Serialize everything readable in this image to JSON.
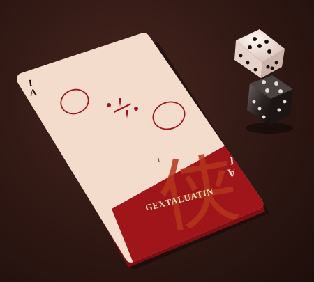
{
  "card": {
    "corner_top": [
      "I",
      "A"
    ],
    "corner_right": [
      "A",
      "I"
    ],
    "center_mark": "I",
    "brand_text": "GEXTALUATIN",
    "colors": {
      "face": "#f4dccd",
      "band": "#a0151a",
      "pattern": "#b3361d",
      "ink": "#a3151a"
    }
  },
  "dice": [
    {
      "name": "white-die",
      "top_face": 5,
      "side_faces": [
        4,
        3
      ]
    },
    {
      "name": "black-die",
      "top_face": 4,
      "side_faces": [
        3,
        2
      ]
    }
  ]
}
